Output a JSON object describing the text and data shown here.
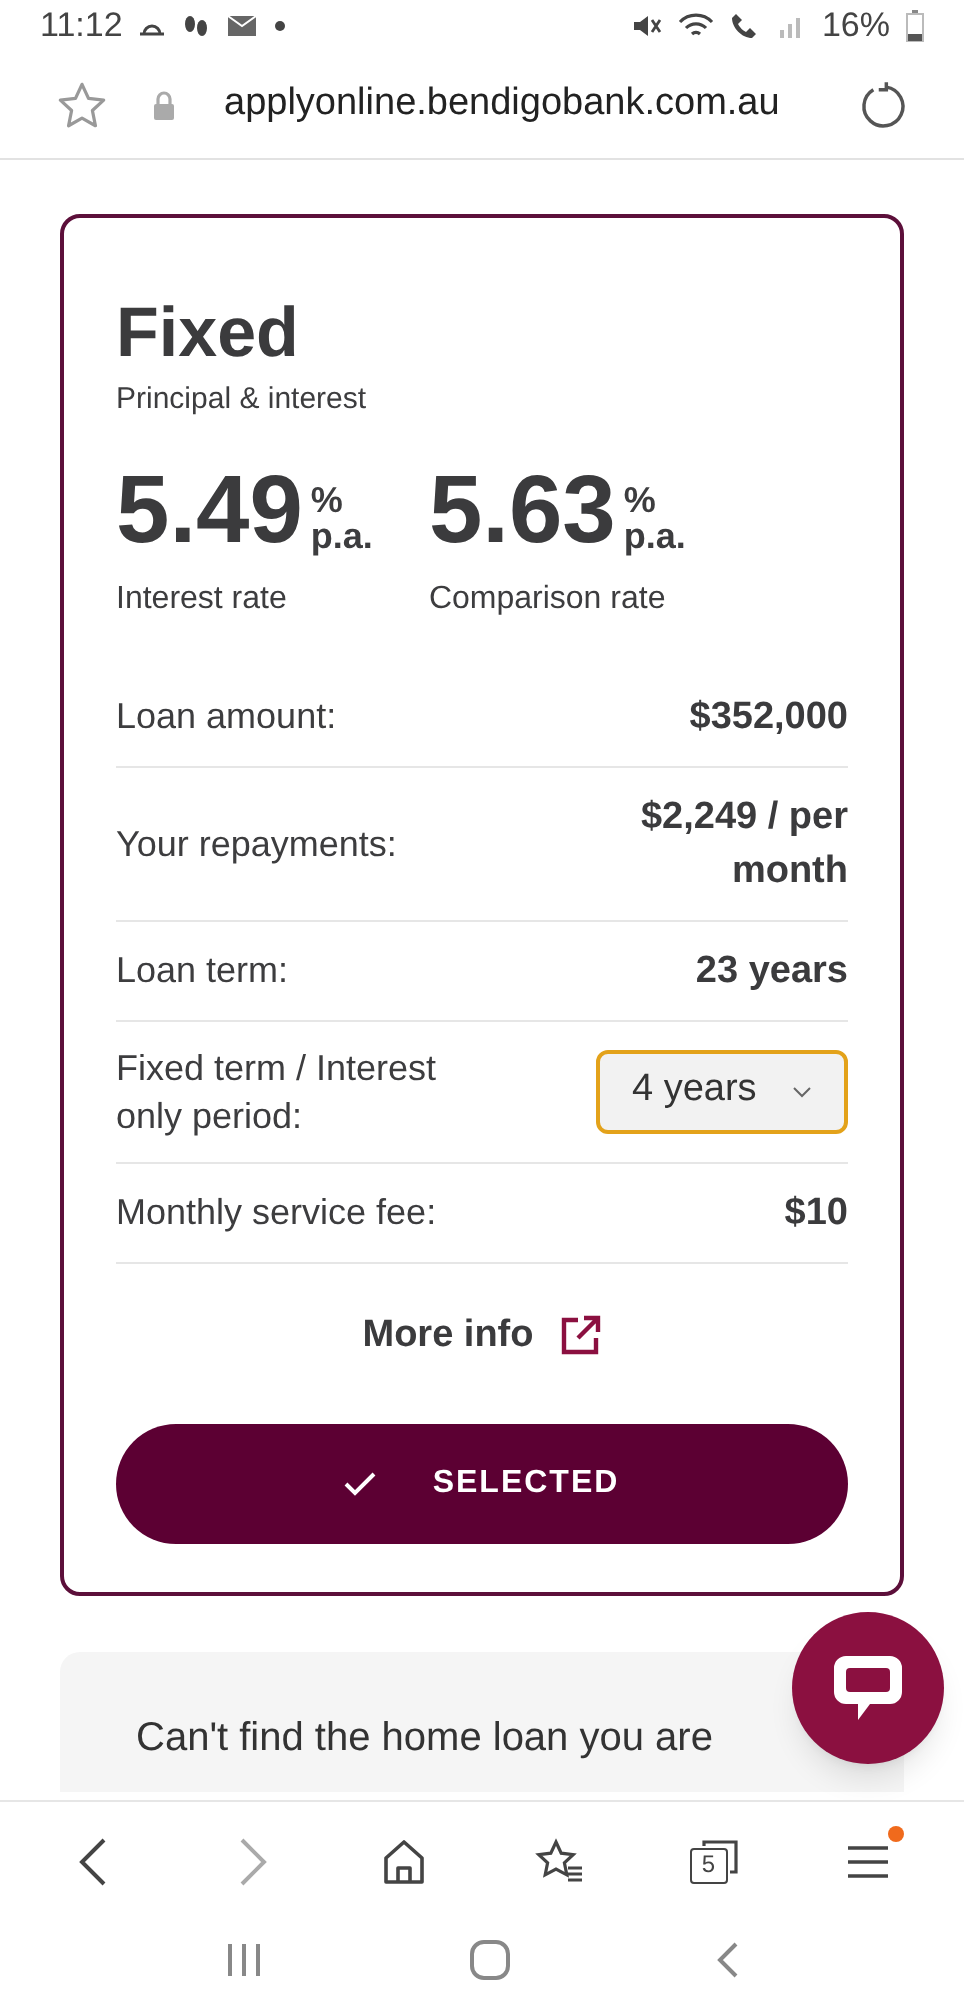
{
  "status_bar": {
    "time": "11:12",
    "battery": "16%"
  },
  "browser": {
    "url": "applyonline.bendigobank.com.au"
  },
  "card": {
    "title": "Fixed",
    "subtitle": "Principal & interest",
    "rates": [
      {
        "value": "5.49",
        "unit_top": "%",
        "unit_bottom": "p.a.",
        "label": "Interest rate"
      },
      {
        "value": "5.63",
        "unit_top": "%",
        "unit_bottom": "p.a.",
        "label": "Comparison rate"
      }
    ],
    "rows": [
      {
        "kind": "text",
        "label": "Loan amount:",
        "value": "$352,000"
      },
      {
        "kind": "text",
        "label": "Your repayments:",
        "value": "$2,249 / per month"
      },
      {
        "kind": "text",
        "label": "Loan term:",
        "value": "23 years"
      },
      {
        "kind": "select",
        "label": "Fixed term / Interest only period:",
        "value": "4 years",
        "focused": true
      },
      {
        "kind": "text",
        "label": "Monthly service fee:",
        "value": "$10"
      }
    ],
    "more_info": "More info",
    "button": {
      "label": "SELECTED",
      "selected": true
    }
  },
  "promo": {
    "text": "Can't find the home loan you are"
  },
  "toolbar": {
    "items": [
      {
        "kind": "back",
        "disabled": false
      },
      {
        "kind": "forward",
        "disabled": true
      },
      {
        "kind": "home",
        "disabled": false
      },
      {
        "kind": "bookmarks",
        "disabled": false
      },
      {
        "kind": "tabs",
        "count": "5",
        "disabled": false
      },
      {
        "kind": "menu",
        "disabled": false,
        "badge": true
      }
    ]
  }
}
